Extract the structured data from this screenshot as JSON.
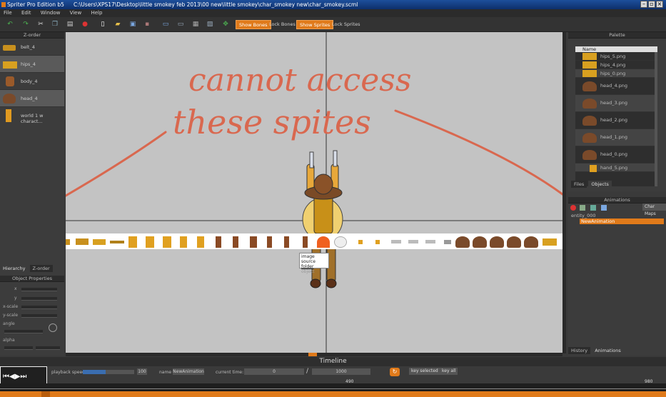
{
  "titlebar": {
    "app": "Spriter Pro Edition b5",
    "path": "C:\\Users\\XPS17\\Desktop\\little smokey feb 2013\\00 new\\little smokey\\char_smokey new\\char_smokey.scml"
  },
  "menu": [
    "File",
    "Edit",
    "Window",
    "View",
    "Help"
  ],
  "toolbar": {
    "show_bones": "Show Bones",
    "lock_bones": "Lock Bones",
    "show_sprites": "Show Sprites",
    "lock_sprites": "Lock Sprites"
  },
  "zorder": {
    "title": "Z-order",
    "items": [
      "belt_4",
      "hips_4",
      "body_4",
      "head_4",
      "world 1 w charact..."
    ],
    "tabs": [
      "Hierarchy",
      "Z-order"
    ]
  },
  "object_properties": {
    "title": "Object Properties",
    "labels": [
      "x",
      "y",
      "x-scale",
      "y-scale",
      "angle",
      "alpha"
    ]
  },
  "canvas": {
    "annotation_line1": "cannot access",
    "annotation_line2": "these spites",
    "tooltip_title": "image source",
    "tooltip_folder": "folder",
    "tooltip_object": "object"
  },
  "palette": {
    "title": "Palette",
    "column": "Name",
    "items": [
      "hips_5.png",
      "hips_4.png",
      "hips_0.png",
      "head_4.png",
      "head_3.png",
      "head_2.png",
      "head_1.png",
      "head_0.png",
      "hand_5.png"
    ],
    "tabs": [
      "Files",
      "Objects"
    ]
  },
  "animations": {
    "title": "Animations",
    "char_maps": "Char Maps",
    "entity": "entity_000",
    "animation": "NewAnimation",
    "tabs": [
      "History",
      "Animations"
    ]
  },
  "timeline": {
    "title": "Timeline",
    "playback_speed_label": "playback speed",
    "playback_speed_value": "100",
    "name_label": "name",
    "name_value": "NewAnimation",
    "current_time_label": "current time:",
    "current_time_value": "0",
    "slash": "/",
    "length_value": "1000",
    "key_selected": "key selected",
    "key_all": "key all",
    "ruler_mid": "490",
    "ruler_end": "980"
  },
  "colors": {
    "accent": "#e07a1a",
    "annotation": "#d9684f",
    "canvas": "#c3c3c3"
  }
}
